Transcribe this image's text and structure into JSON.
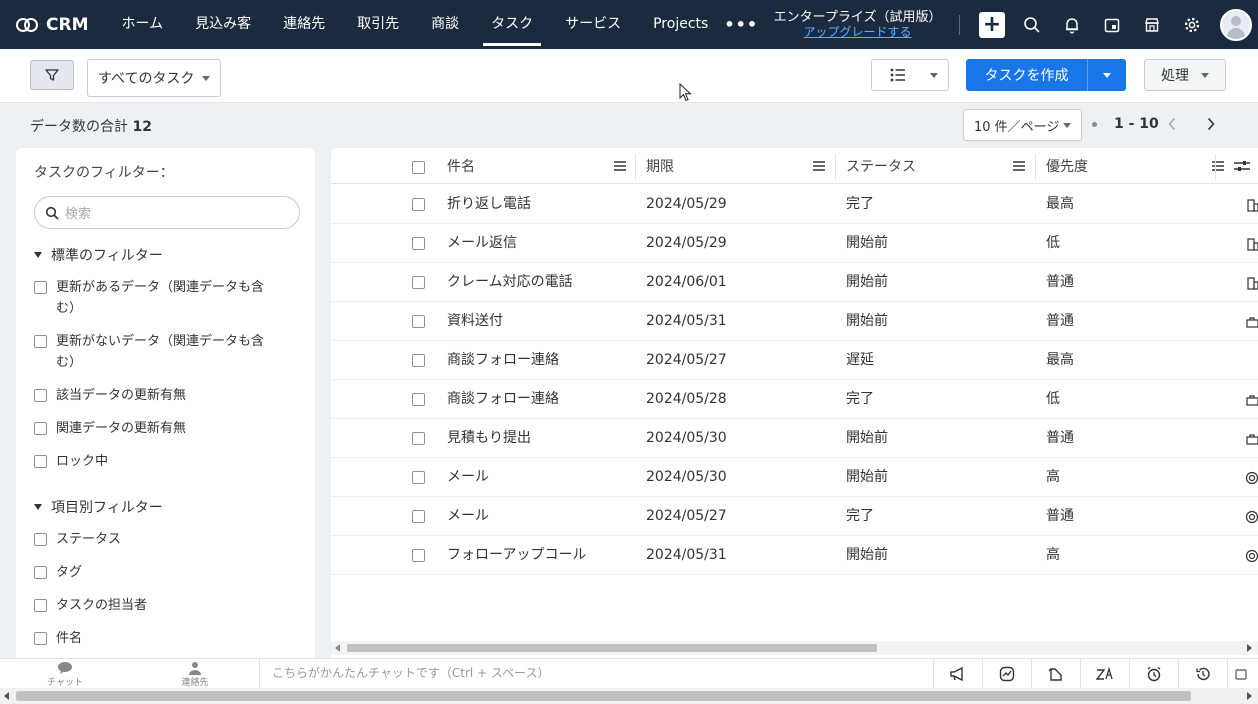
{
  "app": {
    "name": "CRM",
    "nav": [
      "ホーム",
      "見込み客",
      "連絡先",
      "取引先",
      "商談",
      "タスク",
      "サービス",
      "Projects"
    ],
    "active_nav": "タスク",
    "more": "•••",
    "edition_title": "エンタープライズ（試用版）",
    "upgrade_link": "アップグレードする"
  },
  "toolbar": {
    "view_select": "すべてのタスク",
    "create_button": "タスクを作成",
    "action_button": "処理"
  },
  "summary": {
    "label": "データ数の合計",
    "count": "12",
    "per_page": "10 件／ページ",
    "range": "1 - 10"
  },
  "filter_panel": {
    "title": "タスクのフィルター：",
    "search_placeholder": "検索",
    "standard_section": "標準のフィルター",
    "standard_items": [
      "更新があるデータ（関連データも含む）",
      "更新がないデータ（関連データも含む）",
      "該当データの更新有無",
      "関連データの更新有無",
      "ロック中"
    ],
    "field_section": "項目別フィルター",
    "field_items": [
      "ステータス",
      "タグ",
      "タスクの担当者",
      "件名"
    ]
  },
  "table": {
    "columns": [
      "件名",
      "期限",
      "ステータス",
      "優先度"
    ],
    "rows": [
      {
        "subject": "折り返し電話",
        "due": "2024/05/29",
        "status": "完了",
        "priority": "最高",
        "icon": "building-icon"
      },
      {
        "subject": "メール返信",
        "due": "2024/05/29",
        "status": "開始前",
        "priority": "低",
        "icon": "building-icon"
      },
      {
        "subject": "クレーム対応の電話",
        "due": "2024/06/01",
        "status": "開始前",
        "priority": "普通",
        "icon": "building-icon"
      },
      {
        "subject": "資料送付",
        "due": "2024/05/31",
        "status": "開始前",
        "priority": "普通",
        "icon": "briefcase-icon"
      },
      {
        "subject": "商談フォロー連絡",
        "due": "2024/05/27",
        "status": "遅延",
        "priority": "最高",
        "icon": ""
      },
      {
        "subject": "商談フォロー連絡",
        "due": "2024/05/28",
        "status": "完了",
        "priority": "低",
        "icon": "briefcase-icon"
      },
      {
        "subject": "見積もり提出",
        "due": "2024/05/30",
        "status": "開始前",
        "priority": "普通",
        "icon": "briefcase-icon"
      },
      {
        "subject": "メール",
        "due": "2024/05/30",
        "status": "開始前",
        "priority": "高",
        "icon": "target-icon"
      },
      {
        "subject": "メール",
        "due": "2024/05/27",
        "status": "完了",
        "priority": "普通",
        "icon": "target-icon"
      },
      {
        "subject": "フォローアップコール",
        "due": "2024/05/31",
        "status": "開始前",
        "priority": "高",
        "icon": "target-icon"
      }
    ]
  },
  "bottom_bar": {
    "chat_tab": "チャット",
    "contacts_tab": "連絡先",
    "chat_placeholder": "こちらがかんたんチャットです（Ctrl + スペース）"
  },
  "colors": {
    "nav_bg": "#1b2a3e",
    "primary": "#1976e8",
    "link": "#5fb0ff"
  }
}
